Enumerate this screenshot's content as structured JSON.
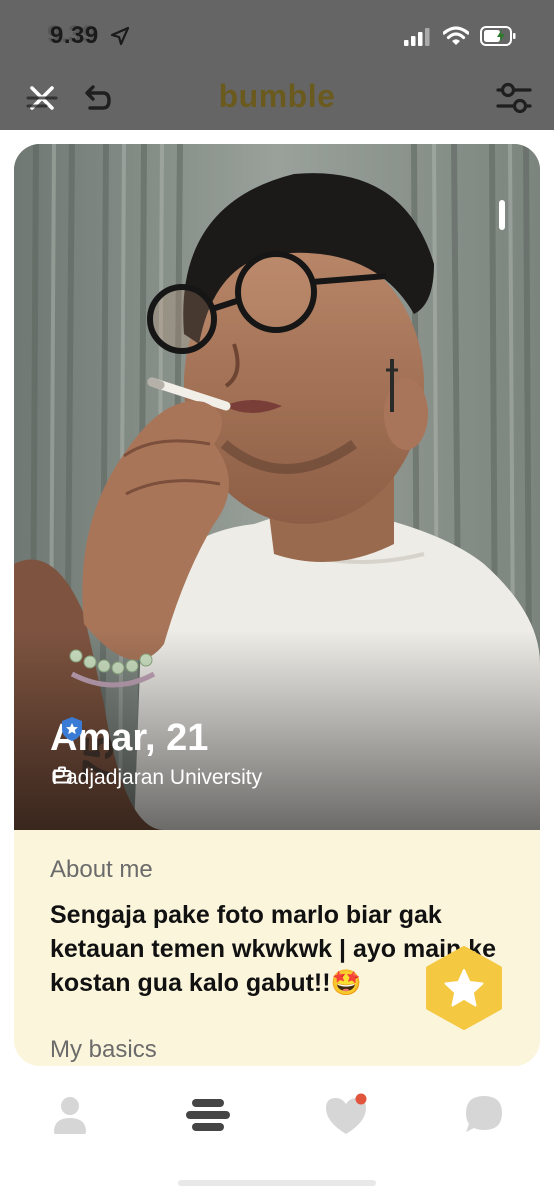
{
  "status_bar": {
    "time": "9.39",
    "icons": [
      "location-arrow-icon",
      "signal-icon",
      "wifi-icon",
      "battery-icon"
    ]
  },
  "nav": {
    "logo": "bumble",
    "icons": [
      "close-icon",
      "undo-icon",
      "filter-icon"
    ]
  },
  "profile": {
    "name_age": "Amar, 21",
    "school": "Padjadjaran University",
    "photo_position": "1 of 2",
    "about_heading": "About me",
    "about_text": "Sengaja pake foto marlo biar gak ketauan temen wkwkwk | ayo main ke kostan gua kalo gabut!!🤩",
    "basics_heading": "My basics"
  },
  "actions": {
    "superswipe_icon": "star-icon"
  },
  "tabbar": {
    "tabs": [
      {
        "icon": "profile-icon",
        "active": false
      },
      {
        "icon": "people-stack-icon",
        "active": true
      },
      {
        "icon": "liked-you-heart-icon",
        "active": false,
        "notification": true
      },
      {
        "icon": "chat-icon",
        "active": false
      }
    ]
  },
  "colors": {
    "brand": "#f5c842",
    "card_bg": "#fbf5dc",
    "notification_dot": "#e0553b",
    "dim_overlay": "#656565"
  }
}
